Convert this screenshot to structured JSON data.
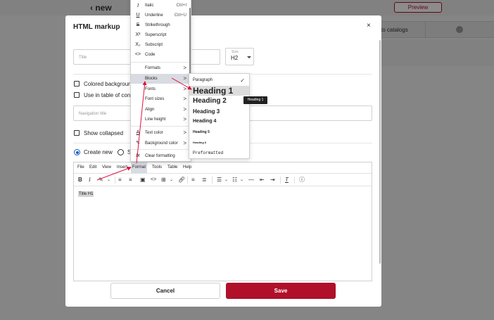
{
  "background": {
    "back_label": "new",
    "preview_label": "Preview",
    "catalog_tab_label": "to catalogs"
  },
  "modal": {
    "title": "HTML markup",
    "title_placeholder": "Title",
    "size_label": "Size",
    "size_value": "H2",
    "colored_background_label": "Colored backgroun",
    "use_in_toc_label": "Use in table of conte",
    "navigation_title_placeholder": "Navigation title",
    "show_collapsed_label": "Show collapsed",
    "create_new_label": "Create new",
    "second_option_initial": "S",
    "cancel_label": "Cancel",
    "save_label": "Save"
  },
  "editor": {
    "menubar": [
      "File",
      "Edit",
      "View",
      "Insert",
      "Format",
      "Tools",
      "Table",
      "Help"
    ],
    "active_menu": "Format",
    "content_text": "Title H1"
  },
  "format_menu": {
    "items": [
      {
        "icon": "I",
        "label": "Italic",
        "shortcut": "Ctrl+I"
      },
      {
        "icon": "U",
        "label": "Underline",
        "shortcut": "Ctrl+U"
      },
      {
        "icon": "S",
        "label": "Strikethrough"
      },
      {
        "icon": "X²",
        "label": "Superscript"
      },
      {
        "icon": "X₂",
        "label": "Subscript"
      },
      {
        "icon": "<>",
        "label": "Code"
      },
      {
        "label": "Formats",
        "arrow": ">"
      },
      {
        "label": "Blocks",
        "arrow": ">"
      },
      {
        "label": "Fonts",
        "arrow": ">"
      },
      {
        "label": "Font sizes",
        "arrow": ">"
      },
      {
        "label": "Align",
        "arrow": ">"
      },
      {
        "label": "Line height",
        "arrow": ">"
      },
      {
        "icon": "A",
        "label": "Text color",
        "arrow": ">"
      },
      {
        "icon": "✎",
        "label": "Background color",
        "arrow": ">"
      },
      {
        "icon": "Ix",
        "label": "Clear formatting"
      }
    ],
    "highlighted": "Blocks"
  },
  "blocks_menu": {
    "items": [
      "Paragraph",
      "Heading 1",
      "Heading 2",
      "Heading 3",
      "Heading 4",
      "Heading 5",
      "Heading 6",
      "Preformatted"
    ],
    "checked": "Paragraph",
    "highlighted": "Heading 1",
    "checkmark": "✓"
  },
  "tooltip": "Heading 1",
  "icons": {
    "close": "×",
    "back": "‹"
  },
  "colors": {
    "accent": "#b0102a",
    "radio": "#1a5ec8",
    "annotation": "#e0103a"
  }
}
